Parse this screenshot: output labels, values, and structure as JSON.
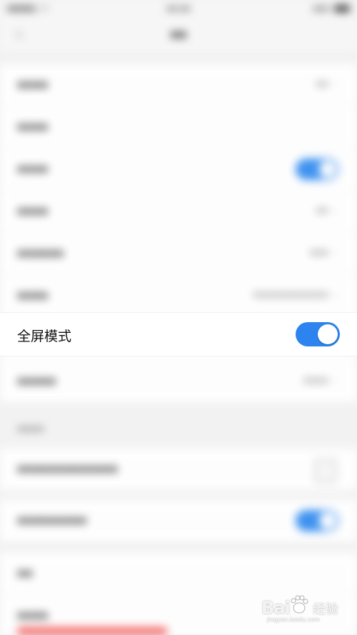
{
  "focused_setting": {
    "label": "全屏模式",
    "enabled": true
  },
  "colors": {
    "toggle_on": "#2d84ee",
    "background": "#f2f2f2",
    "row_background": "#ffffff"
  },
  "watermark": {
    "brand": "Bai",
    "brand_suffix": "经验",
    "sub": "jingyan.baidu.com",
    "paw_icon": "baidu-paw-icon"
  }
}
